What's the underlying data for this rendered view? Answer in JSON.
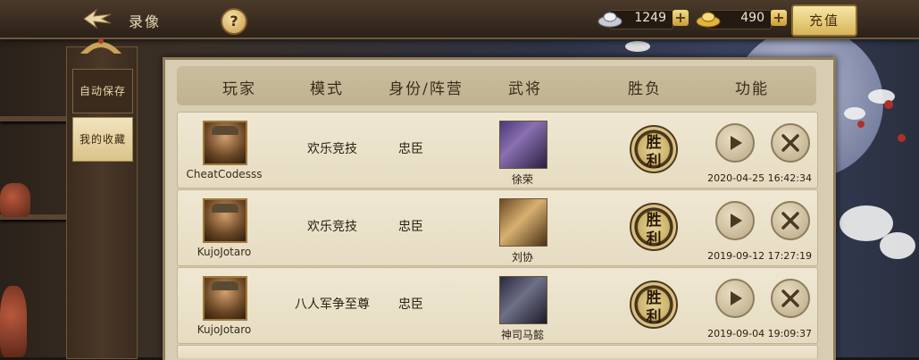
{
  "top_bar": {
    "title": "录像",
    "help_label": "?",
    "silver_amount": "1249",
    "gold_amount": "490",
    "plus_label": "+",
    "recharge_label": "充值"
  },
  "sidebar": {
    "tabs": [
      {
        "label": "自动保存",
        "active": false
      },
      {
        "label": "我的收藏",
        "active": true
      }
    ]
  },
  "table": {
    "headers": [
      "玩家",
      "模式",
      "身份/阵营",
      "武将",
      "胜负",
      "功能"
    ],
    "rows": [
      {
        "player": "CheatCodesss",
        "mode": "欢乐竞技",
        "identity": "忠臣",
        "general": "徐荣",
        "result": "胜利",
        "time": "2020-04-25 16:42:34"
      },
      {
        "player": "KujoJotaro",
        "mode": "欢乐竞技",
        "identity": "忠臣",
        "general": "刘协",
        "result": "胜利",
        "time": "2019-09-12 17:27:19"
      },
      {
        "player": "KujoJotaro",
        "mode": "八人军争至尊",
        "identity": "忠臣",
        "general": "神司马懿",
        "result": "胜利",
        "time": "2019-09-04 19:09:37"
      }
    ],
    "result_chars": [
      "胜",
      "利"
    ]
  },
  "icons": {
    "back": "back-icon",
    "silver": "silver-ingot-icon",
    "gold": "gold-ingot-icon",
    "play": "play-icon",
    "delete": "close-icon"
  }
}
